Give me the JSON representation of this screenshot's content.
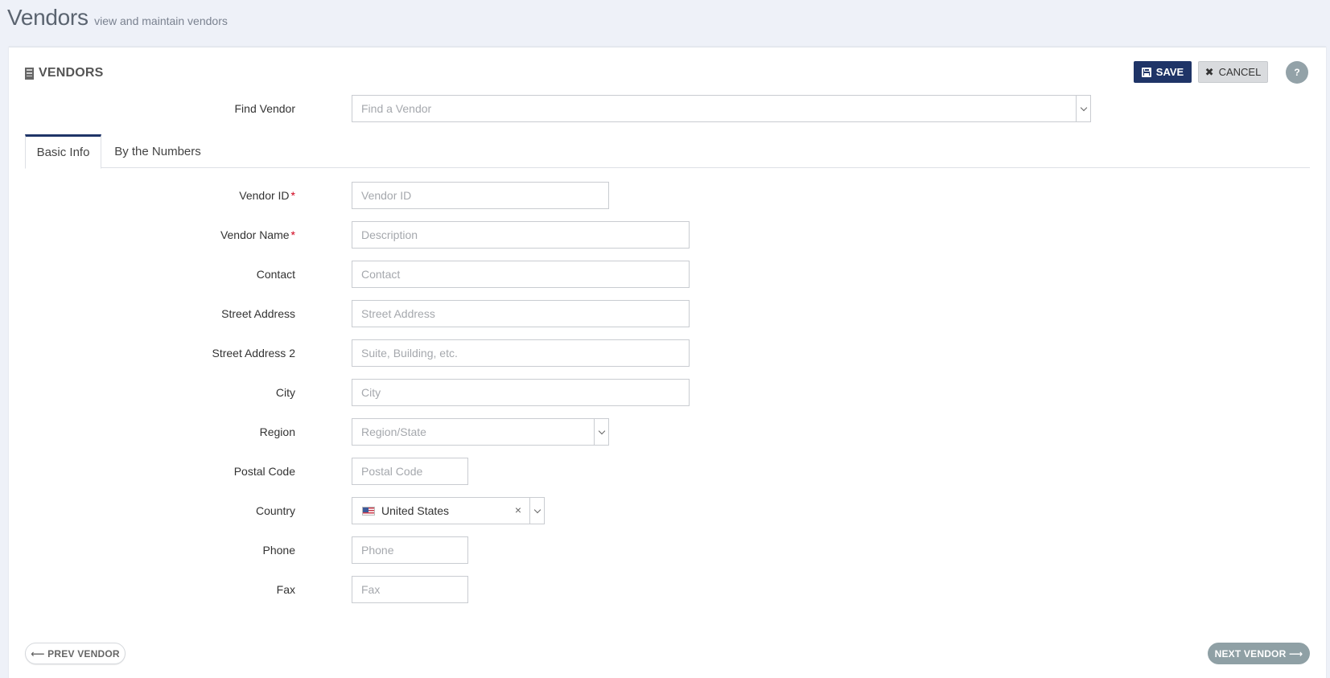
{
  "header": {
    "title": "Vendors",
    "subtitle": "view and maintain vendors"
  },
  "panel": {
    "title": "VENDORS",
    "save_label": "SAVE",
    "cancel_label": "CANCEL",
    "help_label": "?"
  },
  "find_vendor": {
    "label": "Find Vendor",
    "placeholder": "Find a Vendor"
  },
  "tabs": [
    {
      "label": "Basic Info",
      "active": true
    },
    {
      "label": "By the Numbers",
      "active": false
    }
  ],
  "form": {
    "vendor_id": {
      "label": "Vendor ID",
      "placeholder": "Vendor ID",
      "required": true
    },
    "vendor_name": {
      "label": "Vendor Name",
      "placeholder": "Description",
      "required": true
    },
    "contact": {
      "label": "Contact",
      "placeholder": "Contact"
    },
    "street_address": {
      "label": "Street Address",
      "placeholder": "Street Address"
    },
    "street_address_2": {
      "label": "Street Address 2",
      "placeholder": "Suite, Building, etc."
    },
    "city": {
      "label": "City",
      "placeholder": "City"
    },
    "region": {
      "label": "Region",
      "placeholder": "Region/State"
    },
    "postal_code": {
      "label": "Postal Code",
      "placeholder": "Postal Code"
    },
    "country": {
      "label": "Country",
      "value": "United States",
      "clear": "×"
    },
    "phone": {
      "label": "Phone",
      "placeholder": "Phone"
    },
    "fax": {
      "label": "Fax",
      "placeholder": "Fax"
    },
    "required_marker": "*"
  },
  "footer": {
    "prev_label": "⟵ PREV VENDOR",
    "next_label": "NEXT VENDOR ⟶"
  },
  "colors": {
    "accent": "#1f3467",
    "required": "#d0021b",
    "background": "#eef1f8"
  },
  "icons": [
    "building-icon",
    "floppy-disk-icon",
    "close-icon",
    "help-icon",
    "chevron-down-icon",
    "us-flag-icon"
  ]
}
